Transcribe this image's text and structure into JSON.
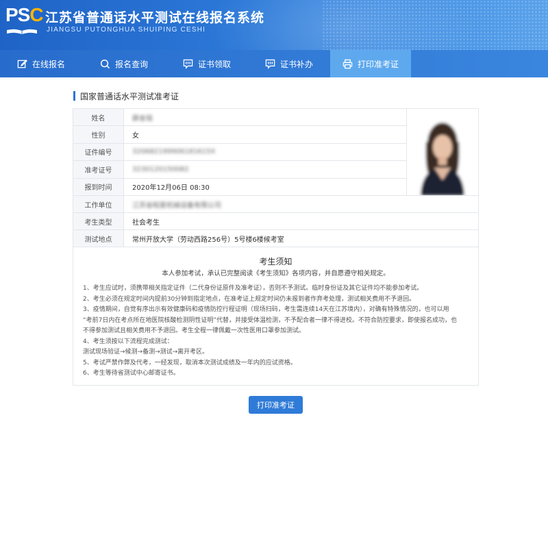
{
  "header": {
    "logo_text_a": "PS",
    "logo_text_b": "C",
    "title_cn": "江苏省普通话水平测试在线报名系统",
    "title_en": "JIANGSU PUTONGHUA SHUIPING CESHI"
  },
  "nav": {
    "items": [
      {
        "label": "在线报名",
        "icon": "edit-icon"
      },
      {
        "label": "报名查询",
        "icon": "search-icon"
      },
      {
        "label": "证书领取",
        "icon": "message-icon"
      },
      {
        "label": "证书补办",
        "icon": "message-icon"
      },
      {
        "label": "打印准考证",
        "icon": "printer-icon",
        "active": true
      }
    ]
  },
  "section": {
    "title": "国家普通话水平测试准考证"
  },
  "ticket": {
    "rows": [
      {
        "label": "姓名",
        "value": "薛金铭"
      },
      {
        "label": "性别",
        "value": "女"
      },
      {
        "label": "证件编号",
        "value": "320682199906181615X"
      },
      {
        "label": "准考证号",
        "value": "3230120150082"
      },
      {
        "label": "报到时间",
        "value": "2020年12月06日 08:30"
      },
      {
        "label": "工作单位",
        "value": "江苏省昭星机械设备有限公司"
      },
      {
        "label": "考生类型",
        "value": "社会考生"
      },
      {
        "label": "测试地点",
        "value": "常州开放大学（劳动西路256号）5号楼6楼候考室"
      }
    ]
  },
  "notice": {
    "title": "考生须知",
    "subtitle": "本人参加考试，承认已完整阅读《考生须知》各项内容，并自愿遵守相关规定。",
    "lines": [
      "1、考生应试时，须携带相关指定证件（二代身份证原件及准考证），否则不予测试。临时身份证及其它证件均不能参加考试。",
      "2、考生必须在规定时间内提前30分钟到指定地点，在准考证上规定时间仍未报到者作弃考处理，测试相关费用不予退回。",
      "3、疫情期间，自觉有序出示有效健康码和疫情防控行程证明（现场扫码，考生需连续14天在江苏境内），对确有特殊情况的，也可以用",
      "“考前7日内在考点所在地医院核酸检测阴性证明”代替，并接受体温检测，不予配合者一律不得进校。不符合防控要求，即使报名成功，也",
      "不得参加测试且相关费用不予退回。考生全程一律佩戴一次性医用口罩参加测试。",
      "4、考生须按以下流程完成测试：",
      "测试现场验证→候测→备测→测试→离开考区。",
      "5、考试严禁作弊及代考，一经发现，取消本次测试成绩及一年内的应试资格。",
      "6、考生等待省测试中心邮寄证书。"
    ]
  },
  "actions": {
    "print_label": "打印准考证"
  },
  "colors": {
    "primary": "#2a74d2",
    "nav_active": "#5ea9ee",
    "button": "#2f7bd8",
    "logo_accent": "#ffb400"
  }
}
